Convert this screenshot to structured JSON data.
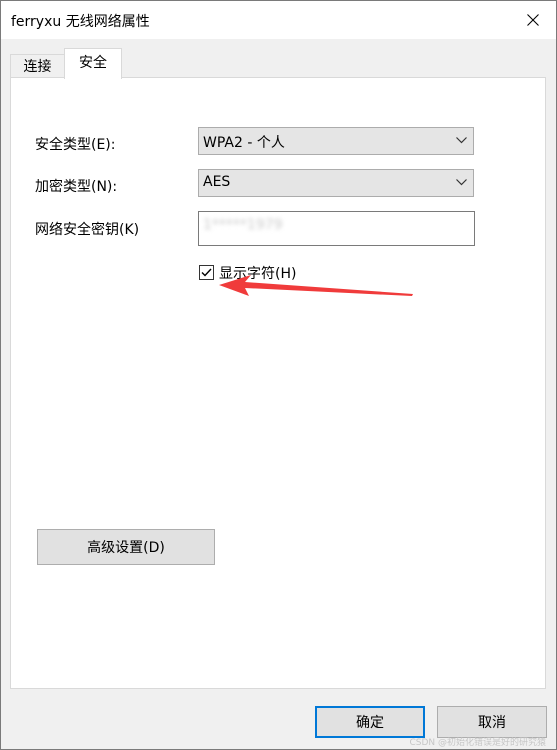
{
  "window": {
    "title": "ferryxu 无线网络属性"
  },
  "tabs": [
    {
      "label": "连接",
      "active": false
    },
    {
      "label": "安全",
      "active": true
    }
  ],
  "security": {
    "security_type_label": "安全类型(E):",
    "security_type_value": "WPA2 - 个人",
    "encryption_type_label": "加密类型(N):",
    "encryption_type_value": "AES",
    "key_label": "网络安全密钥(K)",
    "key_value": "1*****1979",
    "show_chars_label": "显示字符(H)",
    "show_chars_checked": true,
    "advanced_button": "高级设置(D)"
  },
  "footer": {
    "ok_label": "确定",
    "cancel_label": "取消"
  },
  "watermark": "CSDN @初始化错误是好的研究猿",
  "colors": {
    "accent": "#0078d7",
    "annotation_arrow": "#f03b3b"
  },
  "icons": {
    "close": "close-icon",
    "dropdown": "chevron-down-icon",
    "check": "checkmark-icon"
  }
}
